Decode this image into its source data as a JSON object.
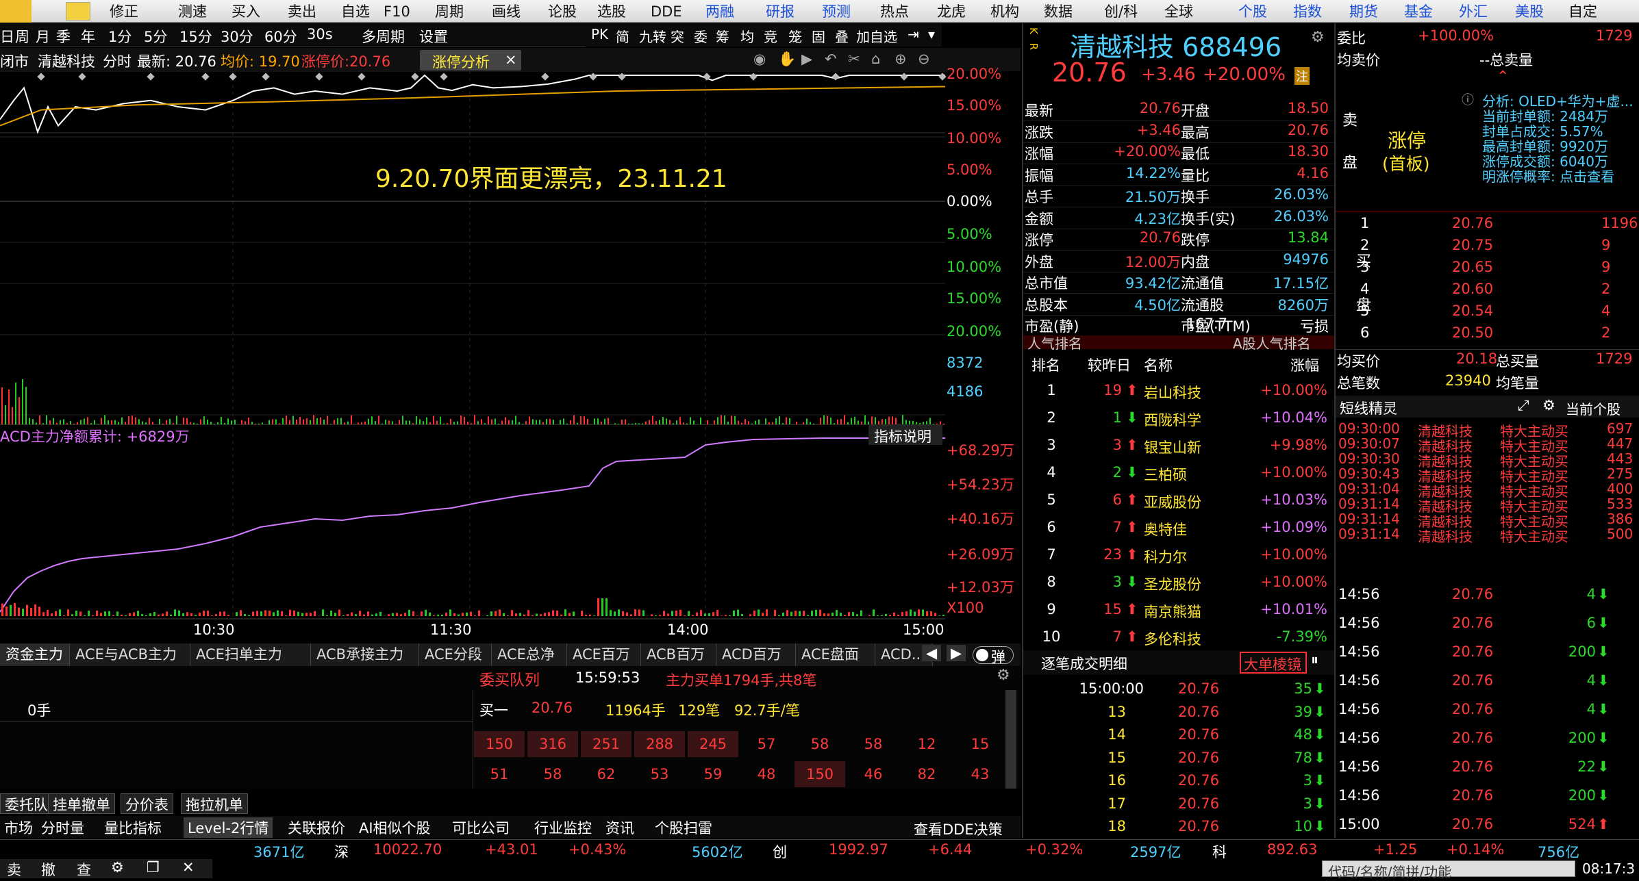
{
  "toolbar": {
    "items": [
      "修正",
      "测速",
      "买入",
      "卖出",
      "自选",
      "F10",
      "周期",
      "画线",
      "论股",
      "选股",
      "DDE",
      "两融",
      "研报",
      "预测",
      "热点",
      "龙虎",
      "机构",
      "数据",
      "创/科",
      "全球",
      "个股",
      "指数",
      "期货",
      "基金",
      "外汇",
      "美股",
      "自定"
    ]
  },
  "period_bar": {
    "items": [
      "日",
      "周",
      "月",
      "季",
      "年",
      "1分",
      "5分",
      "15分",
      "30分",
      "60分",
      "30s",
      "多周期",
      "设置"
    ]
  },
  "tool_icons": [
    "PK",
    "简",
    "九转",
    "突",
    "委",
    "筹",
    "均",
    "竞",
    "笼",
    "固",
    "叠",
    "加自选"
  ],
  "chart_header": {
    "market": "闭市",
    "stock": "清越科技",
    "mode": "分时",
    "latest": "最新: 20.76",
    "avg": "均价: 19.70",
    "limit": "涨停价:20.76",
    "tab": "涨停分析"
  },
  "annotation": "9.20.70界面更漂亮，23.11.21",
  "price_axis": [
    "20.00%",
    "15.00%",
    "10.00%",
    "5.00%",
    "0.00%",
    "5.00%",
    "10.00%",
    "15.00%",
    "20.00%"
  ],
  "volume_axis": [
    "8372",
    "4186"
  ],
  "acd": {
    "title": "ACD主力净额累计: +6829万",
    "btn": "指标说明",
    "axis": [
      "+68.29万",
      "+54.23万",
      "+40.16万",
      "+26.09万",
      "+12.03万",
      "X100"
    ]
  },
  "time_axis": [
    "10:30",
    "11:30",
    "14:00",
    "15:00"
  ],
  "indicator_tabs": [
    "资金主力",
    "ACE与ACB主力",
    "ACE扫单主力",
    "ACB承接主力",
    "ACE分段",
    "ACE总净",
    "ACE百万",
    "ACB百万",
    "ACD百万",
    "ACE盘面",
    "ACD..."
  ],
  "toggle": "弹",
  "queue": {
    "title": "委买队列",
    "time": "15:59:53",
    "main": "主力买单1794手,共8笔",
    "left_val": "0手",
    "bid_label": "买一",
    "bid_price": "20.76",
    "bid_vol": "11964手",
    "bid_count": "129笔",
    "bid_avg": "92.7手/笔",
    "row1": [
      "150",
      "316",
      "251",
      "288",
      "245",
      "57",
      "58",
      "58",
      "12",
      "15"
    ],
    "row2": [
      "51",
      "58",
      "62",
      "53",
      "59",
      "48",
      "150",
      "46",
      "82",
      "43"
    ]
  },
  "bottom_tabs1": [
    "委托队列",
    "挂单撤单",
    "分价表",
    "拖拉机单"
  ],
  "bottom_tabs2": [
    "市场",
    "分时量",
    "量比指标",
    "Level-2行情",
    "关联报价",
    "AI相似个股",
    "可比公司",
    "行业监控",
    "资讯",
    "个股扫雷"
  ],
  "dde_btn": "查看DDE决策",
  "status_bar": {
    "sh_amt": "3671亿",
    "sz_label": "深",
    "sz_idx": "10022.70",
    "sz_chg": "+43.01",
    "sz_pct": "+0.43%",
    "sz_amt": "5602亿",
    "cy_label": "创",
    "cy_idx": "1992.97",
    "cy_chg": "+6.44",
    "cy_pct": "+0.32%",
    "cy_amt": "2597亿",
    "kc_label": "科",
    "kc_idx": "892.63",
    "kc_chg": "+1.25",
    "kc_pct": "+0.14%",
    "kc_amt": "756亿",
    "search_ph": "代码/名称/简拼/功能",
    "clock": "08:17:3"
  },
  "bottom_btns": [
    "卖",
    "撤",
    "查"
  ],
  "quote": {
    "kr": "K R",
    "name": "清越科技 688496",
    "price": "20.76",
    "chg": "+3.46",
    "pct": "+20.00%",
    "tag": "注",
    "rows": [
      [
        "最新",
        "20.76",
        "开盘",
        "18.50"
      ],
      [
        "涨跌",
        "+3.46",
        "最高",
        "20.76"
      ],
      [
        "涨幅",
        "+20.00%",
        "最低",
        "18.30"
      ],
      [
        "振幅",
        "14.22%",
        "量比",
        "4.16"
      ],
      [
        "总手",
        "21.50万",
        "换手",
        "26.03%"
      ],
      [
        "金额",
        "4.23亿",
        "换手(实)",
        "26.03%"
      ],
      [
        "涨停",
        "20.76",
        "跌停",
        "13.84"
      ],
      [
        "外盘",
        "12.00万",
        "内盘",
        "94976"
      ],
      [
        "总市值",
        "93.42亿",
        "流通值",
        "17.15亿"
      ],
      [
        "总股本",
        "4.50亿",
        "流通股",
        "8260万"
      ],
      [
        "市盈(静)",
        "167.7",
        "市盈(TTM)",
        "亏损"
      ]
    ]
  },
  "popularity": {
    "title": "人气排名",
    "right": "A股人气排名",
    "headers": [
      "排名",
      "较昨日",
      "名称",
      "涨幅"
    ],
    "rows": [
      [
        "1",
        "19",
        "岩山科技",
        "+10.00%"
      ],
      [
        "2",
        "1",
        "西陇科学",
        "+10.04%"
      ],
      [
        "3",
        "3",
        "银宝山新",
        "+9.98%"
      ],
      [
        "4",
        "2",
        "三柏硕",
        "+10.00%"
      ],
      [
        "5",
        "6",
        "亚威股份",
        "+10.03%"
      ],
      [
        "6",
        "7",
        "奥特佳",
        "+10.09%"
      ],
      [
        "7",
        "23",
        "科力尔",
        "+10.00%"
      ],
      [
        "8",
        "3",
        "圣龙股份",
        "+10.00%"
      ],
      [
        "9",
        "15",
        "南京熊猫",
        "+10.01%"
      ],
      [
        "10",
        "7",
        "多伦科技",
        "-7.39%"
      ]
    ]
  },
  "tick_detail": {
    "title": "逐笔成交明细",
    "btn": "大单棱镜",
    "rows": [
      [
        "15:00:00",
        "20.76",
        "35"
      ],
      [
        "13",
        "20.76",
        "39"
      ],
      [
        "14",
        "20.76",
        "48"
      ],
      [
        "15",
        "20.76",
        "78"
      ],
      [
        "16",
        "20.76",
        "3"
      ],
      [
        "17",
        "20.76",
        "3"
      ],
      [
        "18",
        "20.76",
        "10"
      ]
    ]
  },
  "order_book": {
    "weibi_label": "委比",
    "weibi": "+100.00%",
    "weicha": "1729",
    "avg_sell_label": "均卖价",
    "total_sell": "--总卖量",
    "limit_label": "涨停",
    "limit_sub": "(首板)",
    "sell_label": "卖",
    "sell_label2": "盘",
    "analysis": [
      "分析: OLED+华为+虚...",
      "当前封单额: 2484万",
      "封单占成交: 5.57%",
      "最高封单额: 9920万",
      "涨停成交额: 6040万",
      "明涨停概率: 点击查看"
    ],
    "bids": [
      [
        "1",
        "20.76",
        "1196"
      ],
      [
        "2",
        "20.75",
        "9"
      ],
      [
        "3",
        "20.65",
        "9"
      ],
      [
        "4",
        "20.60",
        "2"
      ],
      [
        "5",
        "20.54",
        "4"
      ],
      [
        "6",
        "20.50",
        "2"
      ]
    ],
    "buy_label": "买",
    "buy_label2": "盘",
    "avg_buy_label": "均买价",
    "avg_buy": "20.18",
    "total_buy_label": "总买量",
    "total_buy": "1729",
    "trades_label": "总笔数",
    "trades": "23940",
    "avg_vol_label": "均笔量"
  },
  "short_elves": {
    "title": "短线精灵",
    "btn": "当前个股",
    "rows": [
      [
        "09:30:00",
        "清越科技",
        "特大主动买",
        "697"
      ],
      [
        "09:30:07",
        "清越科技",
        "特大主动买",
        "447"
      ],
      [
        "09:30:30",
        "清越科技",
        "特大主动买",
        "443"
      ],
      [
        "09:30:43",
        "清越科技",
        "特大主动买",
        "275"
      ],
      [
        "09:31:04",
        "清越科技",
        "特大主动买",
        "400"
      ],
      [
        "09:31:14",
        "清越科技",
        "特大主动买",
        "533"
      ],
      [
        "09:31:14",
        "清越科技",
        "特大主动买",
        "386"
      ],
      [
        "09:31:14",
        "清越科技",
        "特大主动买",
        "500"
      ]
    ]
  },
  "ticks_right": [
    [
      "14:56",
      "20.76",
      "4"
    ],
    [
      "14:56",
      "20.76",
      "6"
    ],
    [
      "14:56",
      "20.76",
      "200"
    ],
    [
      "14:56",
      "20.76",
      "4"
    ],
    [
      "14:56",
      "20.76",
      "4"
    ],
    [
      "14:56",
      "20.76",
      "200"
    ],
    [
      "14:56",
      "20.76",
      "22"
    ],
    [
      "14:56",
      "20.76",
      "200"
    ],
    [
      "15:00",
      "20.76",
      "524"
    ]
  ]
}
